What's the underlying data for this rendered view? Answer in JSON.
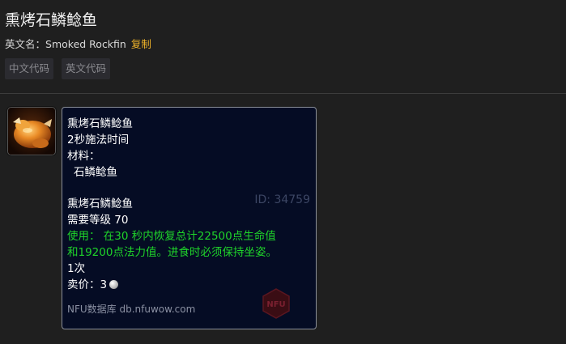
{
  "page": {
    "title": "熏烤石鳞鲶鱼",
    "english_name_label": "英文名：",
    "english_name": "Smoked Rockfin",
    "copy_label": "复制",
    "code_buttons": [
      "中文代码",
      "英文代码"
    ]
  },
  "tooltip": {
    "spell_name": "熏烤石鳞鲶鱼",
    "cast_time": "2秒施法时间",
    "materials_label": "材料：",
    "material_item": "石鳞鲶鱼",
    "item_name": "熏烤石鳞鲶鱼",
    "item_id": "ID: 34759",
    "required_level": "需要等级 70",
    "use_line1": "使用：  在30 秒内恢复总计22500点生命值",
    "use_line2": "和19200点法力值。进食时必须保持坐姿。",
    "charges": "1次",
    "sell_price_label": "卖价：3",
    "footer": "NFU数据库 db.nfuwow.com",
    "logo_text": "NFU"
  },
  "colors": {
    "background": "#1f1f1f",
    "tooltip_bg": "#050c24",
    "use_text": "#1fd42a",
    "copy_link": "#f0b429",
    "item_id": "#3c4664"
  },
  "icons": {
    "item_icon": "roasted-fish-icon",
    "coin_icon": "silver-coin-icon",
    "watermark": "nfu-logo-icon"
  }
}
